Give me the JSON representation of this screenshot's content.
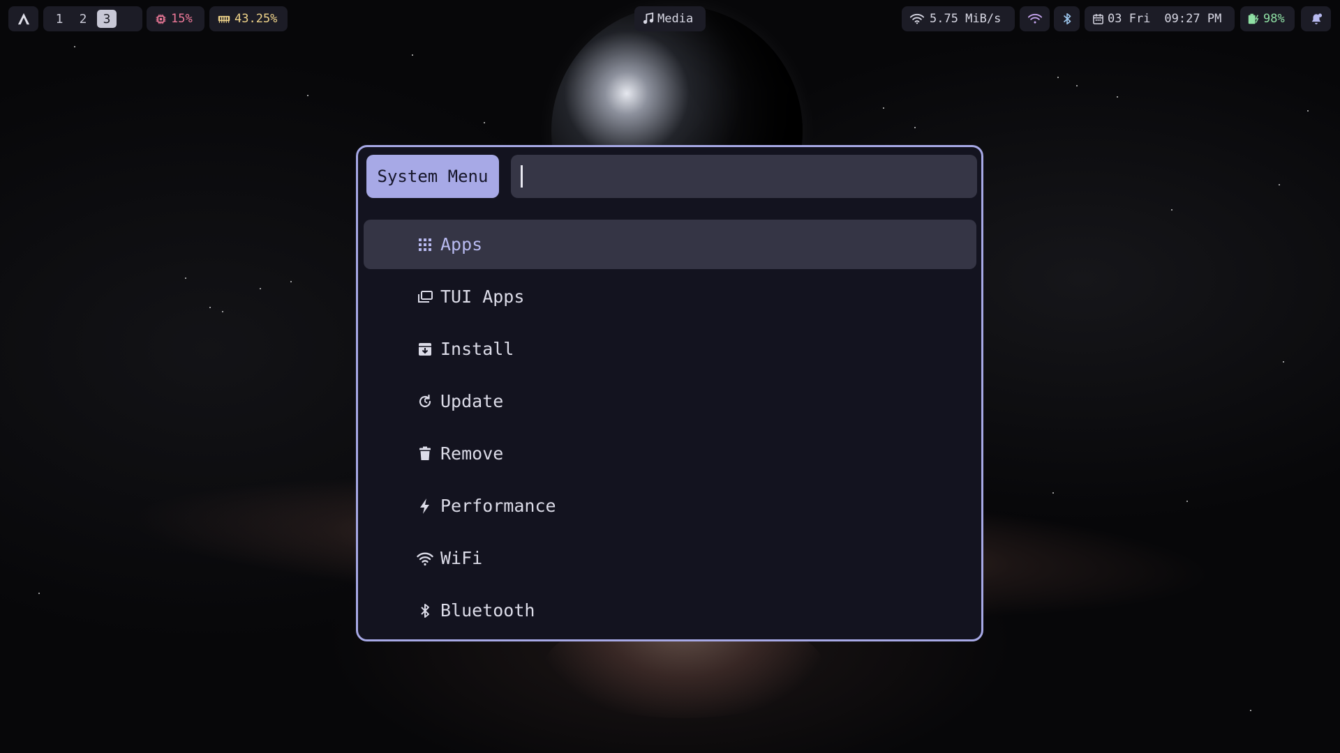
{
  "topbar": {
    "workspaces": [
      "1",
      "2",
      "3"
    ],
    "active_workspace": "3",
    "cpu": "15%",
    "memory": "43.25%",
    "media_label": "Media",
    "network_speed": "5.75 MiB/s",
    "date": "03 Fri",
    "time": "09:27 PM",
    "battery": "98%"
  },
  "launcher": {
    "prompt": "System Menu",
    "search_value": "",
    "items": [
      {
        "label": "Apps",
        "icon": "apps-grid-icon",
        "selected": true
      },
      {
        "label": "TUI Apps",
        "icon": "terminal-windows-icon"
      },
      {
        "label": "Install",
        "icon": "install-box-icon"
      },
      {
        "label": "Update",
        "icon": "update-refresh-icon"
      },
      {
        "label": "Remove",
        "icon": "trash-icon"
      },
      {
        "label": "Performance",
        "icon": "lightning-icon"
      },
      {
        "label": "WiFi",
        "icon": "wifi-icon"
      },
      {
        "label": "Bluetooth",
        "icon": "bluetooth-icon"
      }
    ]
  },
  "colors": {
    "accent": "#a7a9e6",
    "pill_bg": "#1c1c26",
    "cpu": "#f07a9a",
    "memory": "#f0d48a",
    "battery": "#8fe0a4",
    "notification": "#b8baf0"
  }
}
